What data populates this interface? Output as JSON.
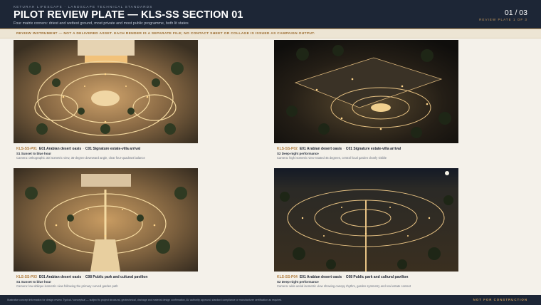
{
  "header": {
    "kicker": "KETURAH LIFESCAPE · LANDSCAPE TECHNICAL STANDARDS",
    "title": "PILOT REVIEW PLATE — KLS-SS SECTION 01",
    "subtitle": "Four matrix corners: driest and wettest ground, most private and most public programme, both lit states",
    "counter": "01 / 03",
    "plate_label": "REVIEW PLATE 1 OF 3"
  },
  "notice": "REVIEW INSTRUMENT — NOT A DELIVERED ASSET. EACH RENDER IS A SEPARATE FILE; NO CONTACT SHEET OR COLLAGE IS ISSUED AS CAMPAIGN OUTPUT.",
  "renders": [
    {
      "code": "KLS-SS-P01",
      "environment": "E01 Arabian desert oasis",
      "separator": "·",
      "brief": "C01 Signature estate-villa arrival",
      "light_state": "S1 Sunset to blue hour",
      "camera": "Camera: orthographic 3D isometric view, 35-degree downward angle, clear four-quadrant balance",
      "scene": "villa-sunset"
    },
    {
      "code": "KLS-SS-P02",
      "environment": "E01 Arabian desert oasis",
      "separator": "·",
      "brief": "C01 Signature estate-villa arrival",
      "light_state": "S2 Deep-night performance",
      "camera": "Camera: high isometric view rotated 45 degrees, central focal garden clearly visible",
      "scene": "villa-night"
    },
    {
      "code": "KLS-SS-P03",
      "environment": "E01 Arabian desert oasis",
      "separator": "·",
      "brief": "C08 Public park and cultural pavilion",
      "light_state": "S1 Sunset to blue hour",
      "camera": "Camera: low-oblique isometric view following the primary curved garden path",
      "scene": "park-sunset"
    },
    {
      "code": "KLS-SS-P04",
      "environment": "E01 Arabian desert oasis",
      "separator": "·",
      "brief": "C08 Public park and cultural pavilion",
      "light_state": "S2 Deep-night performance",
      "camera": "Camera: wide aerial isometric view showing canopy rhythm, garden symmetry and real estate context",
      "scene": "park-night"
    }
  ],
  "footer": {
    "disclaimer": "Illustrative concept information for design review. Typical / conceptual — subject to project structural, geotechnical, drainage and material design confirmation, AV authority approval, standard compliance or manufacturer certification as required.",
    "stamp": "NOT FOR CONSTRUCTION"
  }
}
